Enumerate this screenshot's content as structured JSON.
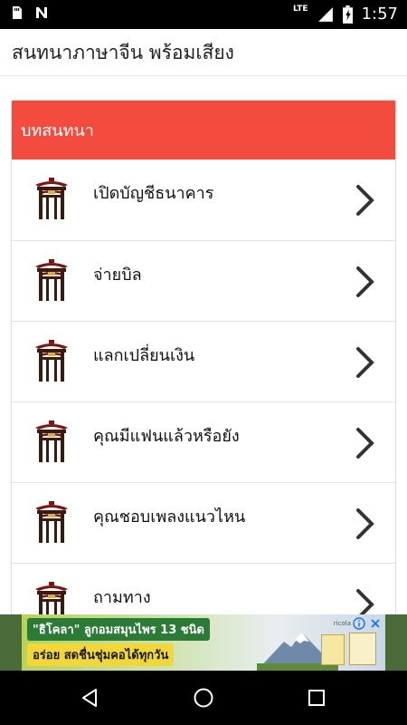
{
  "status_bar": {
    "time": "1:57",
    "network_label": "LTE",
    "icons": [
      "sd-card-icon",
      "notification-n-icon",
      "signal-icon",
      "battery-charging-icon"
    ]
  },
  "app_bar": {
    "title": "สนทนาภาษาจีน พร้อมเสียง"
  },
  "card": {
    "header": "บทสนทนา",
    "items": [
      {
        "label": "เปิดบัญชีธนาคาร",
        "icon": "chinese-gate-icon"
      },
      {
        "label": "จ่ายบิล",
        "icon": "chinese-gate-icon"
      },
      {
        "label": "แลกเปลี่ยนเงิน",
        "icon": "chinese-gate-icon"
      },
      {
        "label": "คุณมีแฟนแล้วหรือยัง",
        "icon": "chinese-gate-icon"
      },
      {
        "label": "คุณชอบเพลงแนวไหน",
        "icon": "chinese-gate-icon"
      },
      {
        "label": "ถามทาง",
        "icon": "chinese-gate-icon"
      }
    ]
  },
  "ad_banner": {
    "line1": "\"ธิโคลา\" ลูกอมสมุนไพร 13 ชนิด",
    "line2": "อร่อย สดชื่นชุ่มคอได้ทุกวัน",
    "brand": "ricola",
    "icons": [
      "ad-info-icon",
      "ad-close-icon"
    ]
  },
  "nav_bar": {
    "icons": [
      "back-icon",
      "home-icon",
      "recents-icon"
    ]
  },
  "colors": {
    "header_red": "#f44b3f",
    "status_bar": "#000000",
    "nav_bar": "#000000",
    "text": "#111111",
    "divider": "#e2e2e2"
  }
}
